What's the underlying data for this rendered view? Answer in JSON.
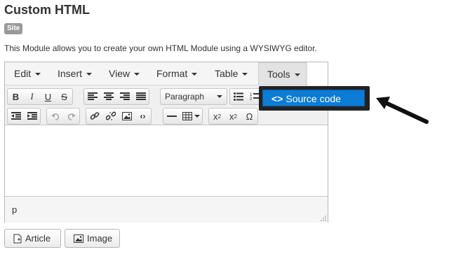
{
  "page": {
    "title": "Custom HTML",
    "badge": "Site",
    "description": "This Module allows you to create your own HTML Module using a WYSIWYG editor."
  },
  "menubar": {
    "items": [
      {
        "label": "Edit"
      },
      {
        "label": "Insert"
      },
      {
        "label": "View"
      },
      {
        "label": "Format"
      },
      {
        "label": "Table"
      },
      {
        "label": "Tools"
      }
    ]
  },
  "toolbar": {
    "format_select": "Paragraph",
    "subscript": "x",
    "superscript": "x",
    "omega": "Ω"
  },
  "dropdown": {
    "source_code_label": "Source code",
    "source_code_icon": "<>"
  },
  "statusbar": {
    "path": "p"
  },
  "buttons": {
    "article": "Article",
    "image": "Image"
  },
  "colors": {
    "highlight": "#0c7cd5",
    "badge": "#999999"
  }
}
